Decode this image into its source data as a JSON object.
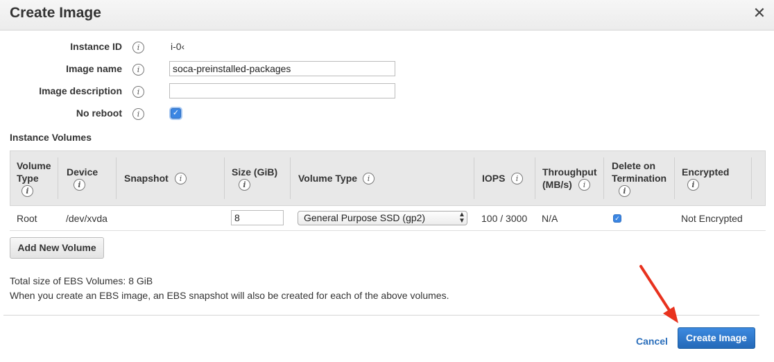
{
  "dialog": {
    "title": "Create Image",
    "close_label": "✕"
  },
  "form": {
    "instance_id": {
      "label": "Instance ID",
      "value": "i-0‹"
    },
    "image_name": {
      "label": "Image name",
      "value": "soca-preinstalled-packages"
    },
    "image_description": {
      "label": "Image description",
      "value": ""
    },
    "no_reboot": {
      "label": "No reboot",
      "checked": true
    }
  },
  "info_glyph": "i",
  "volumes": {
    "section_title": "Instance Volumes",
    "columns": [
      {
        "line1": "Volume",
        "line2": "Type"
      },
      {
        "line1": "Device",
        "line2": ""
      },
      {
        "line1": "Snapshot",
        "line2": ""
      },
      {
        "line1": "Size (GiB)",
        "line2": ""
      },
      {
        "line1": "Volume Type",
        "line2": ""
      },
      {
        "line1": "IOPS",
        "line2": ""
      },
      {
        "line1": "Throughput",
        "line2": "(MB/s)"
      },
      {
        "line1": "Delete on",
        "line2": "Termination"
      },
      {
        "line1": "Encrypted",
        "line2": ""
      }
    ],
    "rows": [
      {
        "volume_type": "Root",
        "device": "/dev/xvda",
        "snapshot": "",
        "size": "8",
        "volume_type_select": "General Purpose SSD (gp2)",
        "iops": "100 / 3000",
        "throughput": "N/A",
        "delete_on_termination": true,
        "encrypted": "Not Encrypted"
      }
    ],
    "add_button": "Add New Volume"
  },
  "notes": {
    "total_size": "Total size of EBS Volumes: 8 GiB",
    "snapshot_note": "When you create an EBS image, an EBS snapshot will also be created for each of the above volumes."
  },
  "footer": {
    "cancel": "Cancel",
    "create": "Create Image"
  },
  "colors": {
    "primary": "#2469b8",
    "link": "#2a6ebb",
    "annotation_arrow": "#e8321e"
  },
  "icons": {
    "close": "close-icon",
    "info": "info-icon",
    "check": "check-icon",
    "select_arrows": "updown-arrows-icon"
  }
}
